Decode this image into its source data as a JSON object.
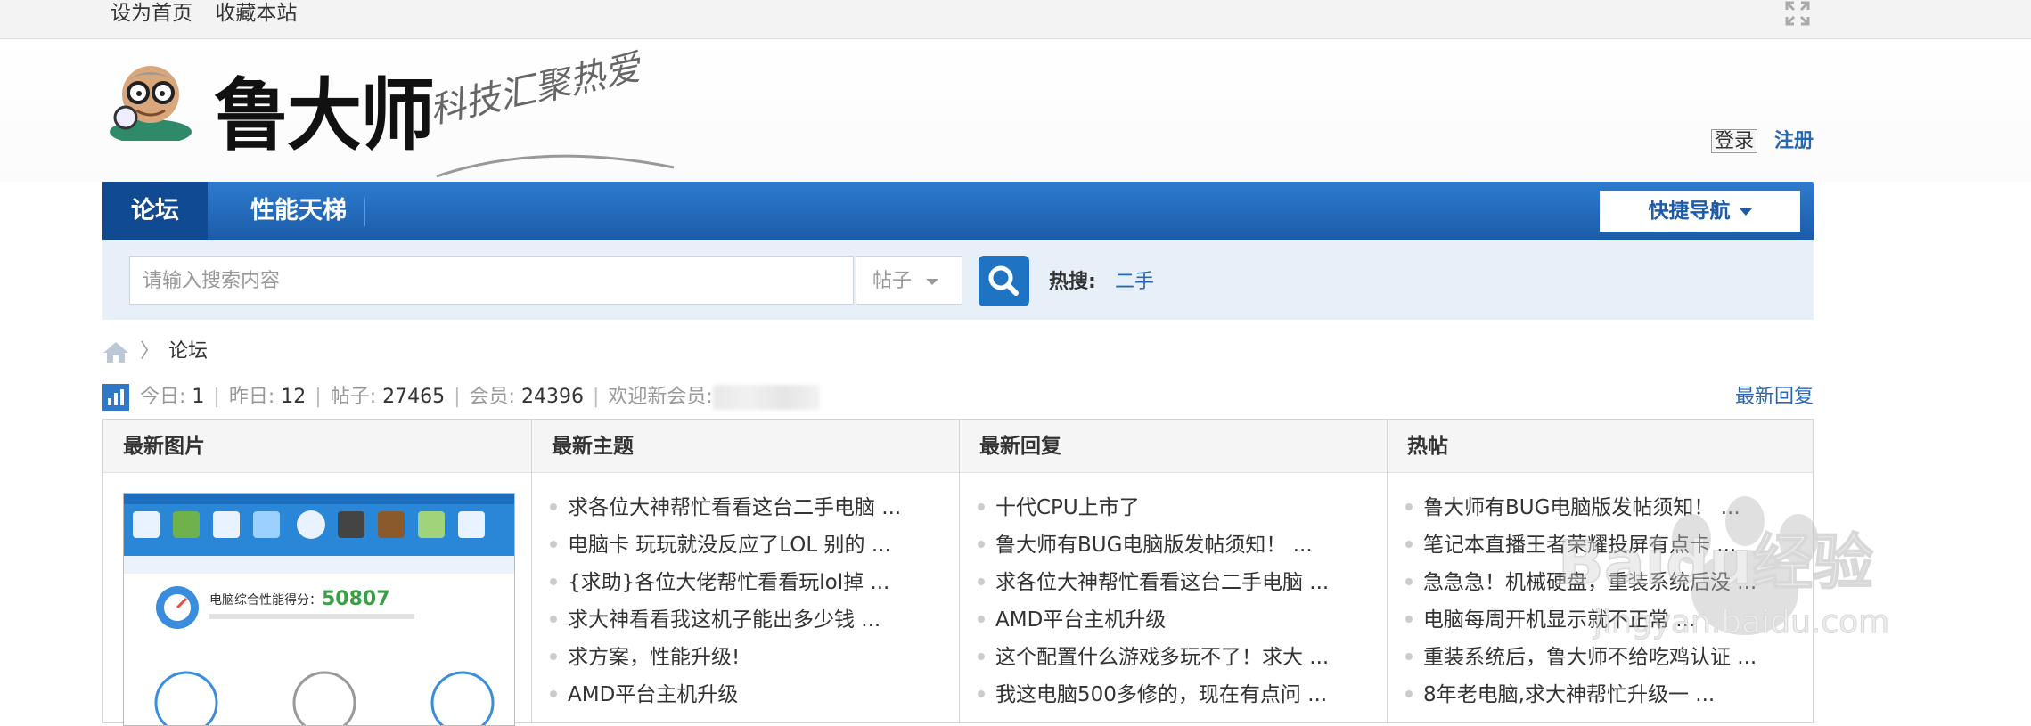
{
  "topbar": {
    "set_home": "设为首页",
    "bookmark": "收藏本站"
  },
  "logo": {
    "name": "鲁大师",
    "slogan": "科技汇聚热爱"
  },
  "auth": {
    "login": "登录",
    "register": "注册"
  },
  "nav": {
    "tabs": [
      {
        "label": "论坛"
      },
      {
        "label": "性能天梯"
      }
    ],
    "quick_nav": "快捷导航"
  },
  "search": {
    "placeholder": "请输入搜索内容",
    "type": "帖子",
    "hot_label": "热搜:",
    "hot_term": "二手"
  },
  "breadcrumb": {
    "current": "论坛"
  },
  "stats": {
    "today_label": "今日:",
    "today": "1",
    "yesterday_label": "昨日:",
    "yesterday": "12",
    "posts_label": "帖子:",
    "posts": "27465",
    "members_label": "会员:",
    "members": "24396",
    "welcome_label": "欢迎新会员:",
    "latest_reply": "最新回复"
  },
  "columns": {
    "pictures": {
      "title": "最新图片",
      "thumb_score_label": "电脑综合性能得分：",
      "thumb_score": "50807"
    },
    "new_topics": {
      "title": "最新主题",
      "items": [
        "求各位大神帮忙看看这台二手电脑 ...",
        "电脑卡 玩玩就没反应了LOL 别的 ...",
        "{求助}各位大佬帮忙看看玩lol掉 ...",
        "求大神看看我这机子能出多少钱 ...",
        "求方案，性能升级!",
        "AMD平台主机升级"
      ]
    },
    "new_replies": {
      "title": "最新回复",
      "items": [
        "十代CPU上市了",
        "鲁大师有BUG电脑版发帖须知！ ...",
        "求各位大神帮忙看看这台二手电脑 ...",
        "AMD平台主机升级",
        "这个配置什么游戏多玩不了！求大 ...",
        "我这电脑500多修的，现在有点问 ..."
      ]
    },
    "hot_posts": {
      "title": "热帖",
      "items": [
        "鲁大师有BUG电脑版发帖须知！ ...",
        "笔记本直播王者荣耀投屏有点卡 ...",
        "急急急！机械硬盘，重装系统后没 ...",
        "电脑每周开机显示就不正常 ...",
        "重装系统后，鲁大师不给吃鸡认证 ...",
        "8年老电脑,求大神帮忙升级一 ..."
      ]
    }
  },
  "watermark": {
    "brand": "Baidu经验",
    "url": "jingyan.baidu.com"
  },
  "colors": {
    "nav_blue": "#1b5ca8",
    "link_blue": "#2a67b1",
    "search_bg": "#e7f0f9"
  }
}
